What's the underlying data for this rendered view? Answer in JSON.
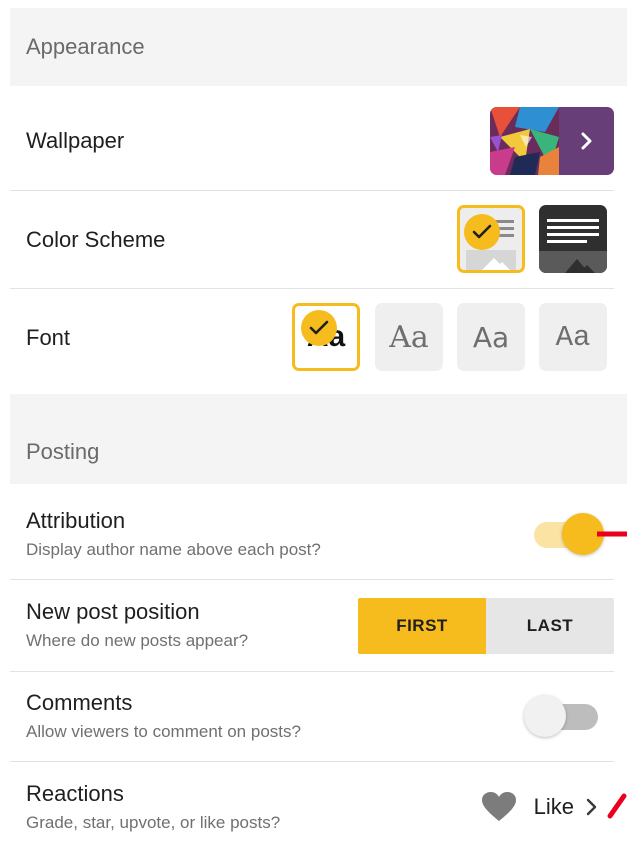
{
  "appearance": {
    "header": "Appearance",
    "wallpaper_label": "Wallpaper",
    "color_scheme_label": "Color Scheme",
    "font_label": "Font",
    "font_options": [
      "Aa",
      "Aa",
      "Aa",
      "Aa"
    ]
  },
  "posting": {
    "header": "Posting",
    "attribution": {
      "title": "Attribution",
      "subtitle": "Display author name above each post?",
      "enabled": true
    },
    "new_post_position": {
      "title": "New post position",
      "subtitle": "Where do new posts appear?",
      "options": [
        "FIRST",
        "LAST"
      ],
      "selected": "FIRST"
    },
    "comments": {
      "title": "Comments",
      "subtitle": "Allow viewers to comment on posts?",
      "enabled": false
    },
    "reactions": {
      "title": "Reactions",
      "subtitle": "Grade, star, upvote, or like posts?",
      "value": "Like"
    }
  },
  "colors": {
    "accent": "#f6bc1e",
    "wallpaper_purple": "#673e78",
    "annotation_red": "#e8001c"
  },
  "icons": [
    "check-icon",
    "chevron-right-icon",
    "heart-icon",
    "image-placeholder-icon"
  ]
}
